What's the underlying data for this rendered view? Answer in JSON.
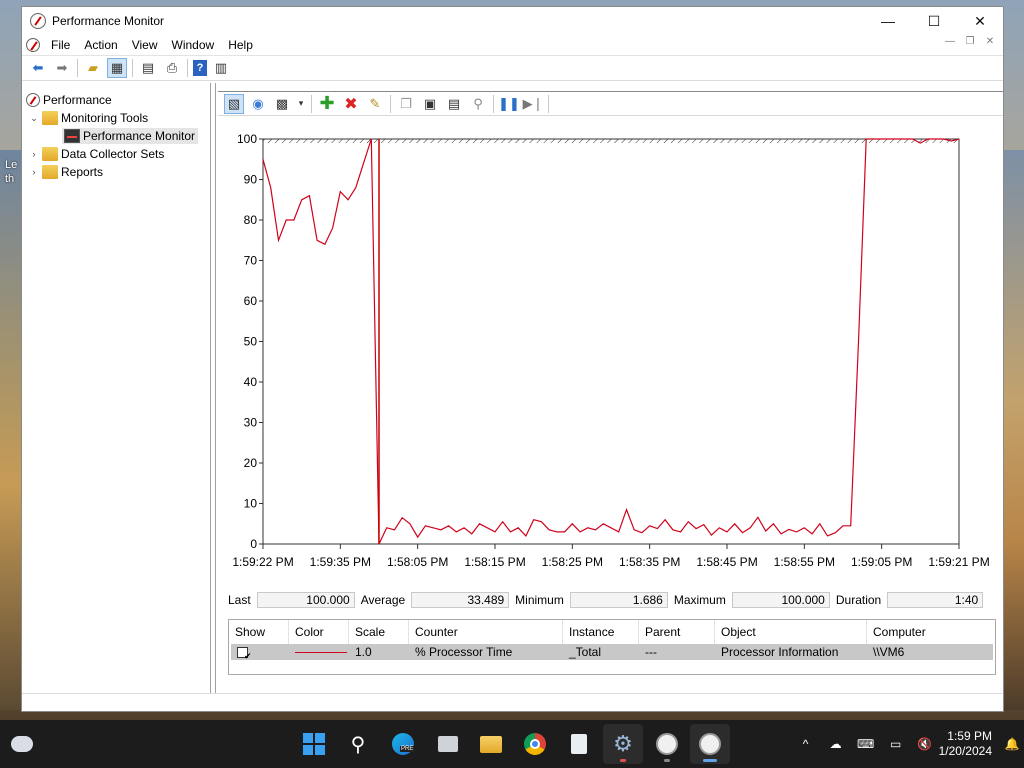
{
  "window": {
    "title": "Performance Monitor",
    "minimize": "—",
    "maximize": "☐",
    "close": "✕"
  },
  "menu": [
    "File",
    "Action",
    "View",
    "Window",
    "Help"
  ],
  "tree": {
    "root": "Performance",
    "monitoring_tools": "Monitoring Tools",
    "performance_monitor": "Performance Monitor",
    "data_collector_sets": "Data Collector Sets",
    "reports": "Reports"
  },
  "desktop_text": [
    "Le",
    "th"
  ],
  "chart_data": {
    "type": "line",
    "ylim": [
      0,
      100
    ],
    "yticks": [
      "0",
      "10",
      "20",
      "30",
      "40",
      "50",
      "60",
      "70",
      "80",
      "90",
      "100"
    ],
    "xticks": [
      "1:59:22 PM",
      "1:59:35 PM",
      "1:58:05 PM",
      "1:58:15 PM",
      "1:58:25 PM",
      "1:58:35 PM",
      "1:58:45 PM",
      "1:58:55 PM",
      "1:59:05 PM",
      "1:59:21 PM"
    ],
    "series": [
      {
        "color": "#d0021b",
        "values": [
          95,
          88,
          75,
          80,
          80,
          85,
          86,
          75,
          74,
          78,
          87,
          85,
          88,
          94,
          100,
          0,
          4,
          3.5,
          6.5,
          5,
          1.7,
          4.5,
          4,
          3.5,
          4.5,
          3,
          4,
          2.5,
          5,
          4,
          3,
          5.5,
          3,
          4,
          2,
          6,
          5.5,
          3.5,
          3,
          3,
          5,
          3,
          4,
          3.5,
          5,
          4,
          3,
          8.5,
          3.5,
          2.8,
          4.5,
          3.8,
          6,
          3.5,
          3,
          5.5,
          3.8,
          4.8,
          2.2,
          4,
          3,
          5,
          2.8,
          4,
          6.6,
          3.2,
          5,
          2.5,
          3.6,
          3,
          4,
          2.5,
          5,
          2,
          2.8,
          4.5,
          4.5,
          50,
          100,
          100,
          100,
          100,
          100,
          100,
          100,
          99,
          100,
          100,
          100,
          99.5,
          100
        ]
      }
    ]
  },
  "stats": {
    "last_label": "Last",
    "last": "100.000",
    "avg_label": "Average",
    "avg": "33.489",
    "min_label": "Minimum",
    "min": "1.686",
    "max_label": "Maximum",
    "max": "100.000",
    "dur_label": "Duration",
    "dur": "1:40"
  },
  "legend": {
    "headers": [
      "Show",
      "Color",
      "Scale",
      "Counter",
      "Instance",
      "Parent",
      "Object",
      "Computer"
    ],
    "row": {
      "show": "✔",
      "scale": "1.0",
      "counter": "% Processor Time",
      "instance": "_Total",
      "parent": "---",
      "object": "Processor Information",
      "computer": "\\\\VM6"
    }
  },
  "taskbar": {
    "time": "1:59 PM",
    "date": "1/20/2024",
    "pre_badge": "PRE"
  }
}
